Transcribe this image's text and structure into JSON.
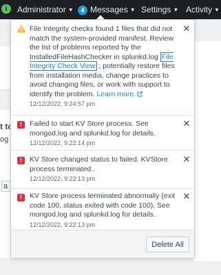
{
  "nav": {
    "app_icon_letter": "i",
    "items": [
      {
        "label": "Administrator"
      },
      {
        "label": "Messages",
        "badge": "4"
      },
      {
        "label": "Settings"
      },
      {
        "label": "Activity"
      }
    ]
  },
  "background": {
    "fragment_1": "t to",
    "fragment_2": "og fo",
    "fragment_3": "a Su"
  },
  "messages": {
    "items": [
      {
        "severity": "warning",
        "text_before_link": "File Integrity checks found 1 files that did not match the system-provided manifest. Review the list of problems reported by the InstalledFileHashChecker in splunkd.log ",
        "link_text": "File Integrity Check View",
        "text_after_link": " ; potentially restore files from installation media, change practices to avoid changing files, or work with support to identify the problem. ",
        "learn_more": "Learn more.",
        "timestamp": "12/12/2022, 9:24:57 pm"
      },
      {
        "severity": "error",
        "text": "Failed to start KV Store process. See mongod.log and splunkd.log for details.",
        "timestamp": "12/12/2022, 9:22:14 pm"
      },
      {
        "severity": "error",
        "text": "KV Store changed status to failed. KVStore process terminated..",
        "timestamp": "12/12/2022, 9:22:13 pm"
      },
      {
        "severity": "error",
        "text": "KV Store process terminated abnormally (exit code 100, status exited with code 100). See mongod.log and splunkd.log for details.",
        "timestamp": "12/12/2022, 9:22:13 pm"
      }
    ],
    "delete_all_label": "Delete All"
  },
  "colors": {
    "nav_bg": "#1c1f23",
    "badge": "#1a9bd7",
    "error": "#d6333b",
    "warning": "#f8be34",
    "link": "#1a86c8"
  },
  "icons": {
    "warning": "warning-triangle-icon",
    "error": "error-exclamation-icon",
    "close": "close-icon",
    "external": "external-link-icon",
    "caret": "caret-down-icon"
  }
}
